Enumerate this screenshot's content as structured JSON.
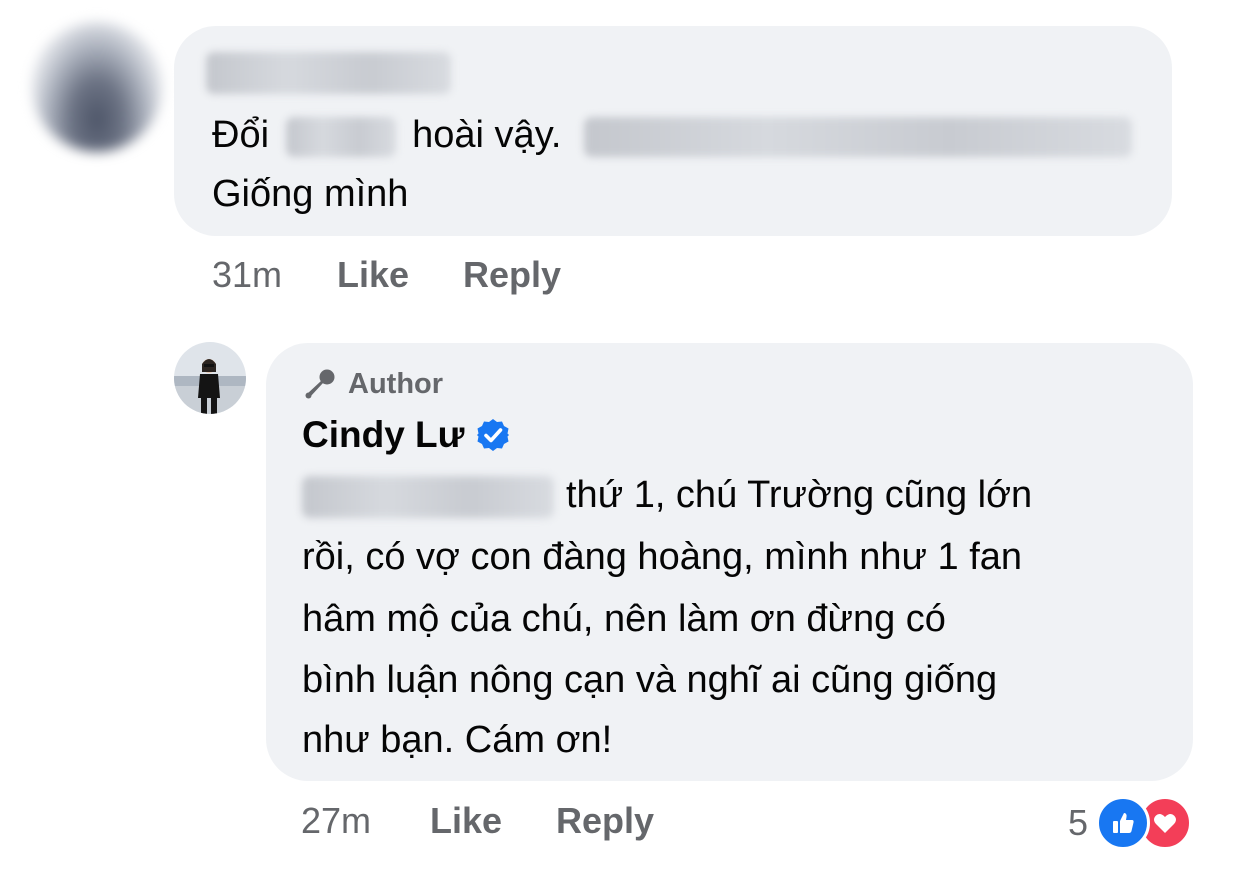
{
  "comment_1": {
    "text_part_1": "Đổi",
    "text_part_2": "hoài vậy.",
    "text_line_2": "Giống mình",
    "time": "31m",
    "like_label": "Like",
    "reply_label": "Reply"
  },
  "comment_2": {
    "author_badge": "Author",
    "author_name": "Cindy Lư",
    "lines": [
      "thứ 1, chú Trường cũng lớn",
      "rồi, có vợ con đàng hoàng, mình như 1 fan",
      "hâm mộ của chú, nên làm ơn đừng có",
      "bình luận nông cạn và nghĩ ai cũng giống",
      "như bạn. Cám ơn!"
    ],
    "time": "27m",
    "like_label": "Like",
    "reply_label": "Reply",
    "reaction_count": "5",
    "reactions": [
      "like-icon",
      "love-icon"
    ]
  },
  "colors": {
    "bubble_bg": "#f0f2f5",
    "meta_text": "#65676b",
    "like_blue": "#1877f2",
    "love_red": "#f33e58"
  }
}
